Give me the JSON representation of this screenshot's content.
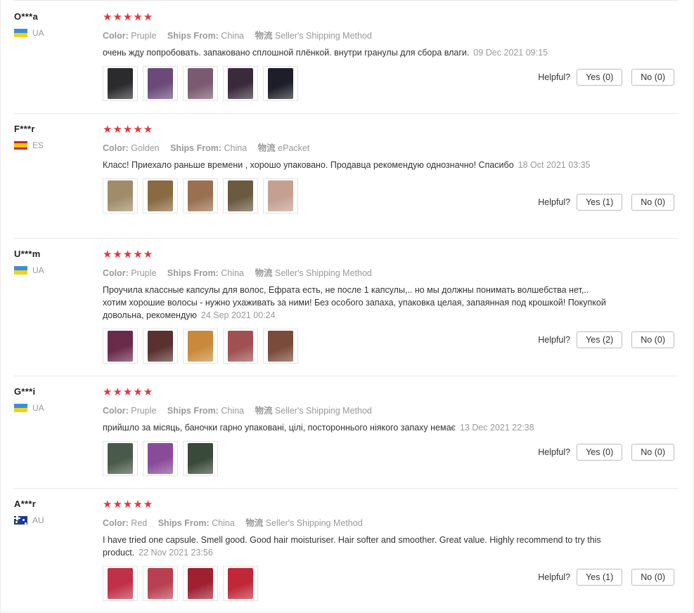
{
  "labels": {
    "color": "Color:",
    "ships_from": "Ships From:",
    "logistics": "物流",
    "helpful": "Helpful?",
    "stars": "★★★★★"
  },
  "reviews": [
    {
      "user": "O***a",
      "country": "UA",
      "color": "Pruple",
      "ships_from": "China",
      "shipping": "Seller's Shipping Method",
      "text": "очень жду попробовать. запаковано сплошной плёнкой. внутри гранулы для сбора влаги.",
      "date": "09 Dec 2021 09:15",
      "yes": "Yes (0)",
      "no": "No (0)",
      "photos": [
        "#2b2b2e",
        "#6b4a7a",
        "#7a5a6e",
        "#3b2a3c",
        "#1e1e28"
      ]
    },
    {
      "user": "F***r",
      "country": "ES",
      "color": "Golden",
      "ships_from": "China",
      "shipping": "ePacket",
      "text": "Класс! Приехало раньше времени , хорошо упаковано. Продавца рекомендую однозначно! Спасибо",
      "date": "18 Oct 2021 03:35",
      "yes": "Yes (1)",
      "no": "No (0)",
      "photos": [
        "#a08c6a",
        "#8a6a42",
        "#9a7050",
        "#6a5a40",
        "#c4a090"
      ]
    },
    {
      "user": "U***m",
      "country": "UA",
      "color": "Pruple",
      "ships_from": "China",
      "shipping": "Seller's Shipping Method",
      "text": "Проучила классные капсулы для волос, Ефрата есть, не после 1 капсулы,.. но мы должны понимать волшебства нет,.. хотим хорошие волосы - нужно ухаживать за ними! Без особого запаха, упаковка целая, запаянная под крошкой! Покупкой довольна, рекомендую",
      "date": "24 Sep 2021 00:24",
      "yes": "Yes (2)",
      "no": "No (0)",
      "photos": [
        "#6a2a4a",
        "#5a3030",
        "#c88a3a",
        "#a05050",
        "#7a4a3a"
      ]
    },
    {
      "user": "G***i",
      "country": "UA",
      "color": "Pruple",
      "ships_from": "China",
      "shipping": "Seller's Shipping Method",
      "text": "прийшло за місяць, баночки гарно упаковані, цілі, постороннього ніякого запаху немає",
      "date": "13 Dec 2021 22:38",
      "yes": "Yes (0)",
      "no": "No (0)",
      "photos": [
        "#4a5a4a",
        "#8a4a9a",
        "#3a4a3a"
      ]
    },
    {
      "user": "A***r",
      "country": "AU",
      "color": "Red",
      "ships_from": "China",
      "shipping": "Seller's Shipping Method",
      "text": "I have tried one capsule. Smell good. Good hair moisturiser. Hair softer and smoother. Great value. Highly recommend to try this product.",
      "date": "22 Nov 2021 23:56",
      "yes": "Yes (1)",
      "no": "No (0)",
      "photos": [
        "#c03048",
        "#b84050",
        "#a02030",
        "#c02838"
      ]
    }
  ]
}
